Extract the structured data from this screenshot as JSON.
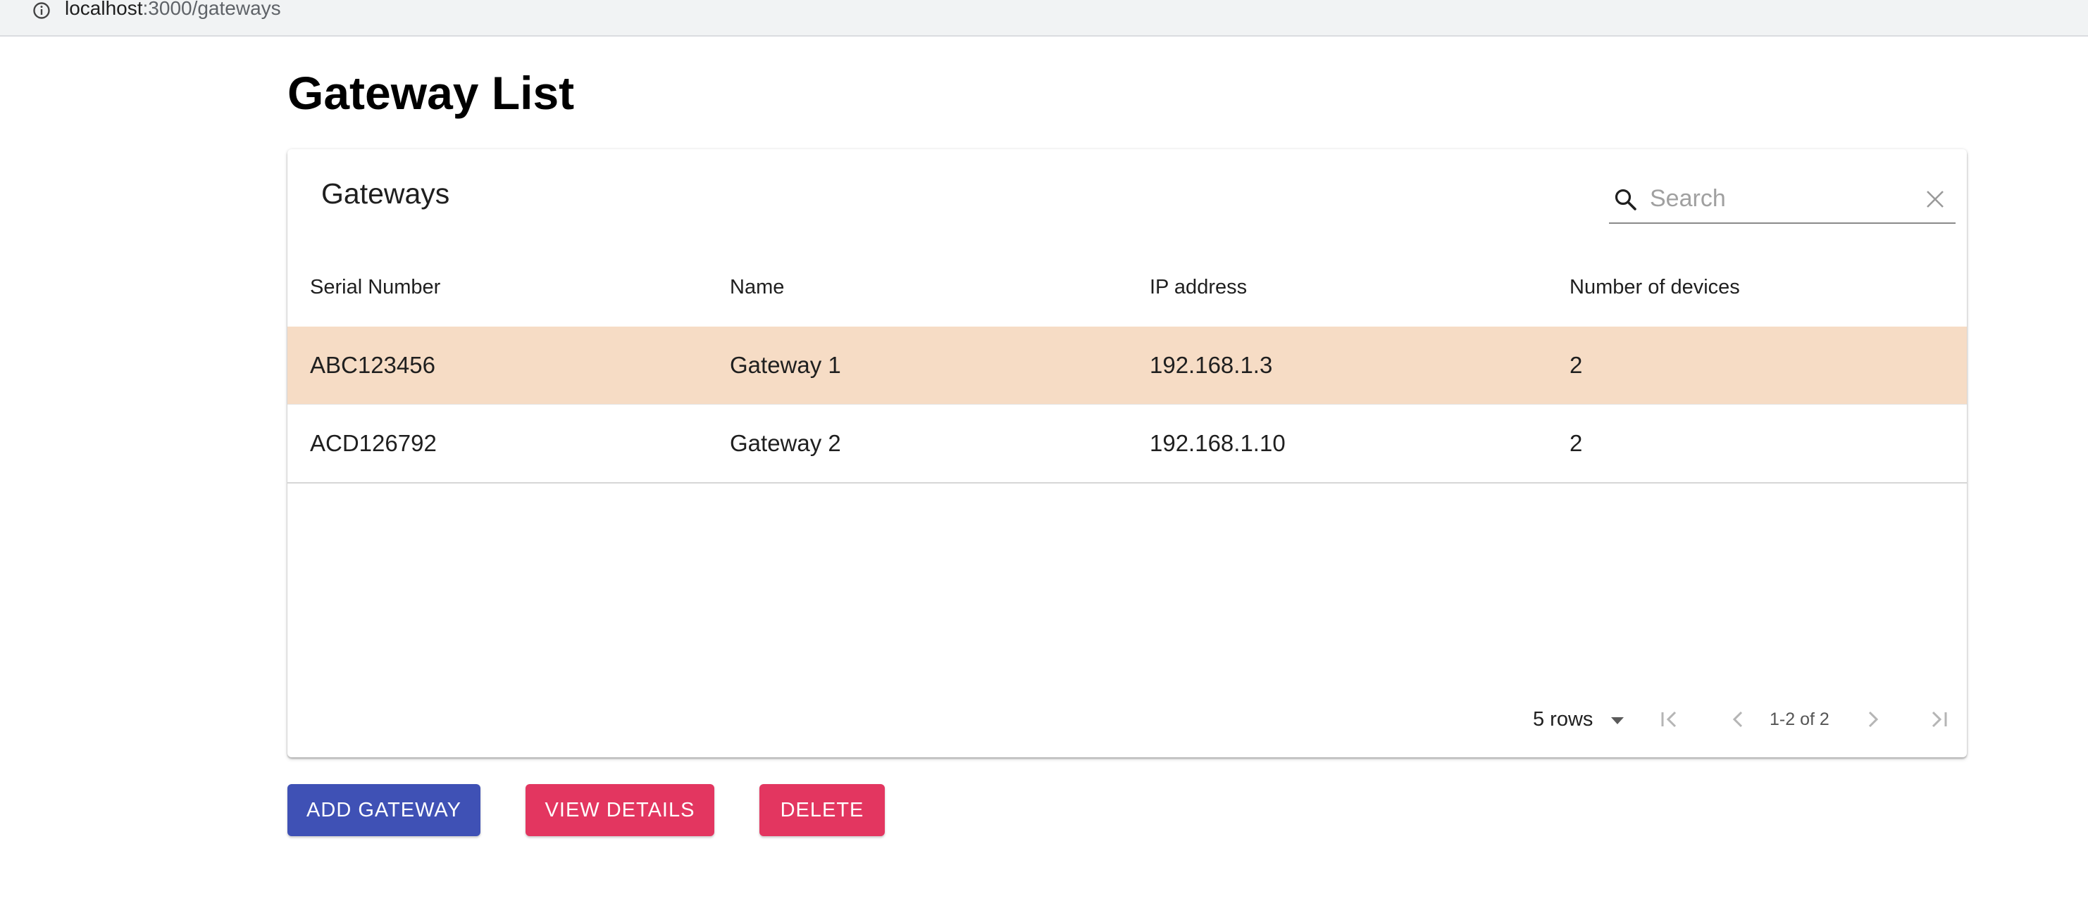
{
  "browser": {
    "url_host": "localhost",
    "url_rest": ":3000/gateways"
  },
  "page": {
    "title": "Gateway List"
  },
  "card": {
    "title": "Gateways",
    "search": {
      "placeholder": "Search",
      "value": ""
    }
  },
  "table": {
    "columns": [
      "Serial Number",
      "Name",
      "IP address",
      "Number of devices"
    ],
    "rows": [
      {
        "serial": "ABC123456",
        "name": "Gateway 1",
        "ip": "192.168.1.3",
        "devices": "2",
        "selected": true
      },
      {
        "serial": "ACD126792",
        "name": "Gateway 2",
        "ip": "192.168.1.10",
        "devices": "2",
        "selected": false
      }
    ],
    "selected_row_color": "#f6dcc5"
  },
  "pagination": {
    "rows_per_page": "5 rows",
    "info": "1-2 of 2"
  },
  "actions": {
    "add_label": "ADD GATEWAY",
    "view_label": "VIEW DETAILS",
    "delete_label": "DELETE",
    "primary_color": "#3f51b5",
    "secondary_color": "#e33660"
  }
}
